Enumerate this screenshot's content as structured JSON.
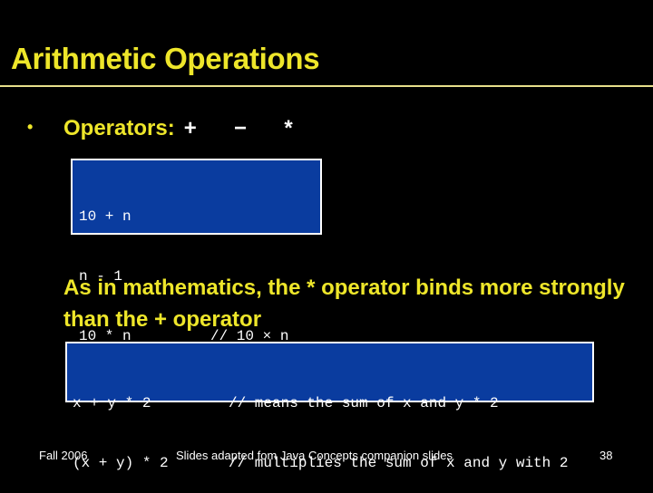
{
  "slide": {
    "title": "Arithmetic Operations",
    "bullet": {
      "icon": "bullet-dot",
      "glyph": "•",
      "label": "Operators:",
      "operators": "+  −  *"
    },
    "code_block_1": {
      "lines": [
        {
          "expr": "10 + n",
          "comment": ""
        },
        {
          "expr": "n - 1",
          "comment": ""
        },
        {
          "expr": "10 * n",
          "comment": "// 10 × n"
        }
      ]
    },
    "statement": "As in mathematics, the * operator binds more strongly than the + operator",
    "code_block_2": {
      "lines": [
        {
          "expr": "x + y * 2",
          "comment": "// means the sum of x and y * 2"
        },
        {
          "expr": "(x + y) * 2",
          "comment": "// multiplies the sum of x and y with 2"
        }
      ]
    }
  },
  "footer": {
    "left": "Fall 2006",
    "center": "Slides adapted fom Java Concepts companion slides",
    "page_number": "38"
  },
  "colors": {
    "background": "#000000",
    "title": "#EEE62A",
    "rule": "#E8E08C",
    "code_box_fill": "#0A3C9F",
    "code_box_border": "#FFFFFF",
    "code_text": "#FFFFFF"
  }
}
